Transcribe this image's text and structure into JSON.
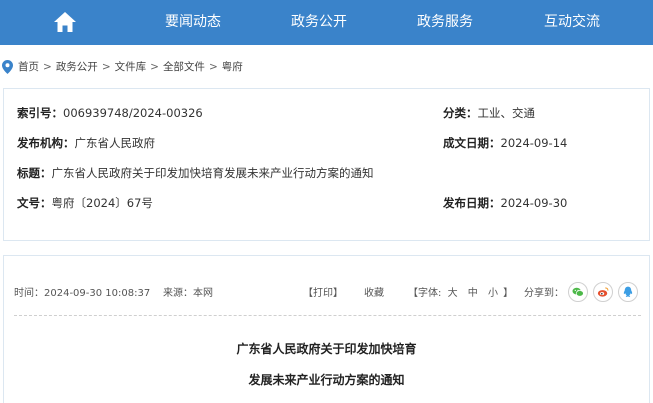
{
  "nav": {
    "home_icon": "home-icon",
    "items": [
      "要闻动态",
      "政务公开",
      "政务服务",
      "互动交流"
    ]
  },
  "breadcrumb": [
    "首页",
    "政务公开",
    "文件库",
    "全部文件",
    "粤府"
  ],
  "meta": {
    "index_label": "索引号：",
    "index_value": "006939748/2024-00326",
    "category_label": "分类：",
    "category_value": "工业、交通",
    "issuer_label": "发布机构：",
    "issuer_value": "广东省人民政府",
    "created_label": "成文日期：",
    "created_value": "2024-09-14",
    "title_label": "标题：",
    "title_value": "广东省人民政府关于印发加快培育发展未来产业行动方案的通知",
    "docno_label": "文号：",
    "docno_value": "粤府〔2024〕67号",
    "published_label": "发布日期：",
    "published_value": "2024-09-30"
  },
  "article": {
    "time": "时间：2024-09-30 10:08:37",
    "source": "来源：本网",
    "print": "【打印】",
    "favorite": "收藏",
    "font_label": "【字体:",
    "font_large": "大",
    "font_medium": "中",
    "font_small": "小",
    "font_close": "】",
    "share_label": "分享到：",
    "share_icons": [
      "wechat-icon",
      "weibo-icon",
      "qq-icon"
    ],
    "title_line1": "广东省人民政府关于印发加快培育",
    "title_line2": "发展未来产业行动方案的通知"
  },
  "colors": {
    "nav_bg": "#3a83ca",
    "pin": "#3a83ca",
    "wechat": "#4cb848",
    "weibo": "#e6502e",
    "qq": "#3c9ee4"
  }
}
